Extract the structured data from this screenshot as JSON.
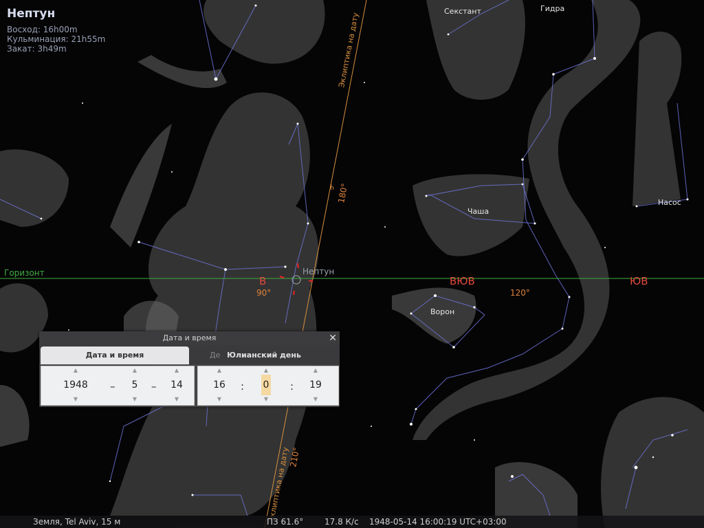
{
  "object_info": {
    "name": "Нептун",
    "rise": "Восход: 16h00m",
    "transit": "Кульминация: 21h55m",
    "set": "Закат: 3h49m"
  },
  "sky_labels": {
    "horizon": "Горизонт",
    "east": "В",
    "ese": "ВЮВ",
    "se": "ЮВ",
    "deg_90": "90°",
    "deg_120": "120°",
    "deg_180": "180°",
    "deg_210": "210°",
    "ecliptic_top": "Эклиптика на дату",
    "ecliptic_bottom": "Эклиптика на дату",
    "neptune_label": "Нептун"
  },
  "constellations": {
    "sextant": "Секстант",
    "hydra": "Гидра",
    "antlia": "Насос",
    "crater": "Чаша",
    "corvus": "Ворон"
  },
  "datetime_dialog": {
    "title": "Дата и время",
    "tab_date_time": "Дата и время",
    "tab_julian": "Юлианский день",
    "tab_hidden_text": "Де",
    "year": "1948",
    "month": "5",
    "day": "14",
    "hour": "16",
    "minute": "0",
    "second": "19",
    "date_sep": "–",
    "time_sep": ":",
    "up_arrow": "▲",
    "down_arrow": "▼",
    "close": "✕"
  },
  "status_bar": {
    "location": "Земля, Tel Aviv, 15 м",
    "fov": "ПЗ 61.6°",
    "fps": "17.8 К/с",
    "datetime": "1948-05-14 16:00:19 UTC+03:00"
  },
  "colors": {
    "horizon": "#3fae3f",
    "cardinal": "#e2483a",
    "ecliptic": "#d9903e",
    "constellation_lines": "#6f74d8"
  }
}
